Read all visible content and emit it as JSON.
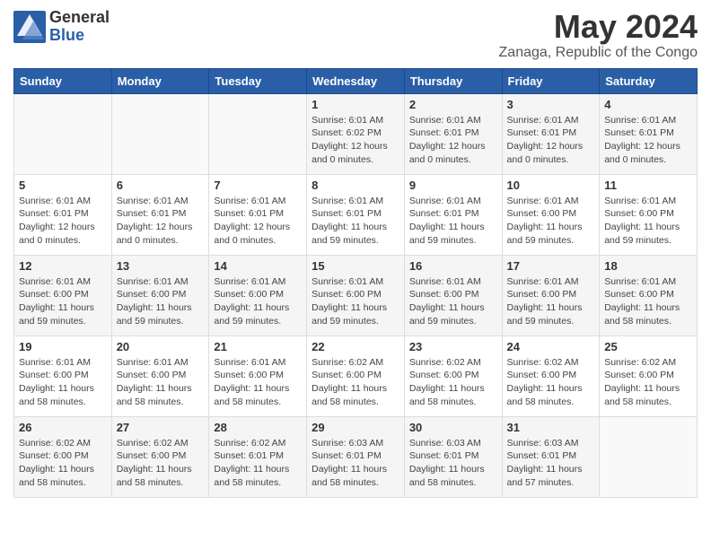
{
  "logo": {
    "general": "General",
    "blue": "Blue"
  },
  "title": "May 2024",
  "location": "Zanaga, Republic of the Congo",
  "days_header": [
    "Sunday",
    "Monday",
    "Tuesday",
    "Wednesday",
    "Thursday",
    "Friday",
    "Saturday"
  ],
  "weeks": [
    [
      {
        "day": "",
        "info": ""
      },
      {
        "day": "",
        "info": ""
      },
      {
        "day": "",
        "info": ""
      },
      {
        "day": "1",
        "info": "Sunrise: 6:01 AM\nSunset: 6:02 PM\nDaylight: 12 hours\nand 0 minutes."
      },
      {
        "day": "2",
        "info": "Sunrise: 6:01 AM\nSunset: 6:01 PM\nDaylight: 12 hours\nand 0 minutes."
      },
      {
        "day": "3",
        "info": "Sunrise: 6:01 AM\nSunset: 6:01 PM\nDaylight: 12 hours\nand 0 minutes."
      },
      {
        "day": "4",
        "info": "Sunrise: 6:01 AM\nSunset: 6:01 PM\nDaylight: 12 hours\nand 0 minutes."
      }
    ],
    [
      {
        "day": "5",
        "info": "Sunrise: 6:01 AM\nSunset: 6:01 PM\nDaylight: 12 hours\nand 0 minutes."
      },
      {
        "day": "6",
        "info": "Sunrise: 6:01 AM\nSunset: 6:01 PM\nDaylight: 12 hours\nand 0 minutes."
      },
      {
        "day": "7",
        "info": "Sunrise: 6:01 AM\nSunset: 6:01 PM\nDaylight: 12 hours\nand 0 minutes."
      },
      {
        "day": "8",
        "info": "Sunrise: 6:01 AM\nSunset: 6:01 PM\nDaylight: 11 hours\nand 59 minutes."
      },
      {
        "day": "9",
        "info": "Sunrise: 6:01 AM\nSunset: 6:01 PM\nDaylight: 11 hours\nand 59 minutes."
      },
      {
        "day": "10",
        "info": "Sunrise: 6:01 AM\nSunset: 6:00 PM\nDaylight: 11 hours\nand 59 minutes."
      },
      {
        "day": "11",
        "info": "Sunrise: 6:01 AM\nSunset: 6:00 PM\nDaylight: 11 hours\nand 59 minutes."
      }
    ],
    [
      {
        "day": "12",
        "info": "Sunrise: 6:01 AM\nSunset: 6:00 PM\nDaylight: 11 hours\nand 59 minutes."
      },
      {
        "day": "13",
        "info": "Sunrise: 6:01 AM\nSunset: 6:00 PM\nDaylight: 11 hours\nand 59 minutes."
      },
      {
        "day": "14",
        "info": "Sunrise: 6:01 AM\nSunset: 6:00 PM\nDaylight: 11 hours\nand 59 minutes."
      },
      {
        "day": "15",
        "info": "Sunrise: 6:01 AM\nSunset: 6:00 PM\nDaylight: 11 hours\nand 59 minutes."
      },
      {
        "day": "16",
        "info": "Sunrise: 6:01 AM\nSunset: 6:00 PM\nDaylight: 11 hours\nand 59 minutes."
      },
      {
        "day": "17",
        "info": "Sunrise: 6:01 AM\nSunset: 6:00 PM\nDaylight: 11 hours\nand 59 minutes."
      },
      {
        "day": "18",
        "info": "Sunrise: 6:01 AM\nSunset: 6:00 PM\nDaylight: 11 hours\nand 58 minutes."
      }
    ],
    [
      {
        "day": "19",
        "info": "Sunrise: 6:01 AM\nSunset: 6:00 PM\nDaylight: 11 hours\nand 58 minutes."
      },
      {
        "day": "20",
        "info": "Sunrise: 6:01 AM\nSunset: 6:00 PM\nDaylight: 11 hours\nand 58 minutes."
      },
      {
        "day": "21",
        "info": "Sunrise: 6:01 AM\nSunset: 6:00 PM\nDaylight: 11 hours\nand 58 minutes."
      },
      {
        "day": "22",
        "info": "Sunrise: 6:02 AM\nSunset: 6:00 PM\nDaylight: 11 hours\nand 58 minutes."
      },
      {
        "day": "23",
        "info": "Sunrise: 6:02 AM\nSunset: 6:00 PM\nDaylight: 11 hours\nand 58 minutes."
      },
      {
        "day": "24",
        "info": "Sunrise: 6:02 AM\nSunset: 6:00 PM\nDaylight: 11 hours\nand 58 minutes."
      },
      {
        "day": "25",
        "info": "Sunrise: 6:02 AM\nSunset: 6:00 PM\nDaylight: 11 hours\nand 58 minutes."
      }
    ],
    [
      {
        "day": "26",
        "info": "Sunrise: 6:02 AM\nSunset: 6:00 PM\nDaylight: 11 hours\nand 58 minutes."
      },
      {
        "day": "27",
        "info": "Sunrise: 6:02 AM\nSunset: 6:00 PM\nDaylight: 11 hours\nand 58 minutes."
      },
      {
        "day": "28",
        "info": "Sunrise: 6:02 AM\nSunset: 6:01 PM\nDaylight: 11 hours\nand 58 minutes."
      },
      {
        "day": "29",
        "info": "Sunrise: 6:03 AM\nSunset: 6:01 PM\nDaylight: 11 hours\nand 58 minutes."
      },
      {
        "day": "30",
        "info": "Sunrise: 6:03 AM\nSunset: 6:01 PM\nDaylight: 11 hours\nand 58 minutes."
      },
      {
        "day": "31",
        "info": "Sunrise: 6:03 AM\nSunset: 6:01 PM\nDaylight: 11 hours\nand 57 minutes."
      },
      {
        "day": "",
        "info": ""
      }
    ]
  ]
}
